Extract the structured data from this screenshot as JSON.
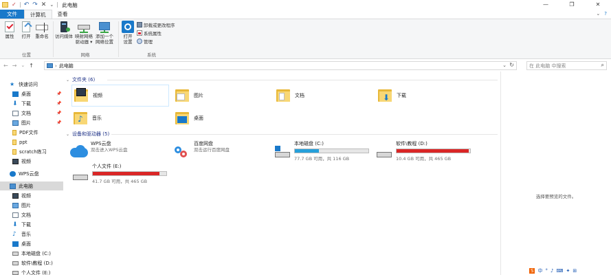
{
  "window": {
    "title": "此电脑",
    "min": "—",
    "max": "❐",
    "close": "✕"
  },
  "quick_access_toolbar": {
    "undo": "↶",
    "redo": "↷",
    "delete": "✕",
    "props": "✓",
    "dropdown": "⌄"
  },
  "ribbon_tabs": [
    {
      "label": "文件"
    },
    {
      "label": "计算机"
    },
    {
      "label": "查看"
    }
  ],
  "ribbon_right": {
    "collapse": "⌄",
    "help": "?"
  },
  "ribbon": {
    "location": {
      "name": "位置",
      "properties": "属性",
      "open": "打开",
      "rename": "重命名"
    },
    "network": {
      "name": "网络",
      "media_line1": "访问媒体",
      "map_line1": "映射网络",
      "map_line2": "驱动器 ▾",
      "add_line1": "添加一个",
      "add_line2": "网络位置"
    },
    "system": {
      "name": "系统",
      "open_settings_line1": "打开",
      "open_settings_line2": "设置",
      "uninstall": "卸载或更改程序",
      "sysprops": "系统属性",
      "manage": "管理"
    }
  },
  "nav": {
    "back": "←",
    "forward": "→",
    "recent": "⌄",
    "up": "↑",
    "path_sep": "›",
    "path": "此电脑",
    "path_chevron": "⌄",
    "refresh": "↻",
    "search_placeholder": "在 此电脑 中搜索",
    "search_icon": "⌕"
  },
  "sidebar": {
    "quick_access": "快速访问",
    "quick_items": [
      {
        "label": "桌面"
      },
      {
        "label": "下载"
      },
      {
        "label": "文档"
      },
      {
        "label": "图片"
      },
      {
        "label": "PDF文件"
      },
      {
        "label": "ppt"
      },
      {
        "label": "scratch练习"
      },
      {
        "label": "视频"
      }
    ],
    "pin": "📌",
    "wps": "WPS云盘",
    "this_pc": "此电脑",
    "pc_items": [
      {
        "label": "视频"
      },
      {
        "label": "图片"
      },
      {
        "label": "文档"
      },
      {
        "label": "下载"
      },
      {
        "label": "音乐"
      },
      {
        "label": "桌面"
      },
      {
        "label": "本地磁盘 (C:)"
      },
      {
        "label": "软件\\教程 (D:)"
      },
      {
        "label": "个人文件 (E:)"
      }
    ]
  },
  "content": {
    "folders_header": "文件夹 (6)",
    "folders": [
      {
        "label": "视频"
      },
      {
        "label": "图片"
      },
      {
        "label": "文档"
      },
      {
        "label": "下载"
      },
      {
        "label": "音乐"
      },
      {
        "label": "桌面"
      }
    ],
    "devices_header": "设备和驱动器 (5)",
    "caret": "⌄",
    "wps": {
      "name": "WPS云盘",
      "sub": "双击进入WPS云盘"
    },
    "baidu": {
      "name": "百度网盘",
      "sub": "双击运行百度网盘"
    },
    "drives": [
      {
        "name": "本地磁盘 (C:)",
        "size": "77.7 GB 可用，共 116 GB",
        "used": 0.33
      },
      {
        "name": "软件\\教程 (D:)",
        "size": "10.4 GB 可用，共 465 GB",
        "used": 0.98
      },
      {
        "name": "个人文件 (E:)",
        "size": "41.7 GB 可用，共 465 GB",
        "used": 0.91
      }
    ]
  },
  "preview": {
    "message": "选择要预览的文件。"
  },
  "tray": {
    "s": "S",
    "items": [
      "中",
      "°",
      "♪",
      "⌨",
      "✦",
      "⊞"
    ]
  },
  "colors": {
    "accent": "#1979ca",
    "drive_blue": "#26a0da",
    "drive_red": "#da2626",
    "selection": "#cce8ff"
  }
}
